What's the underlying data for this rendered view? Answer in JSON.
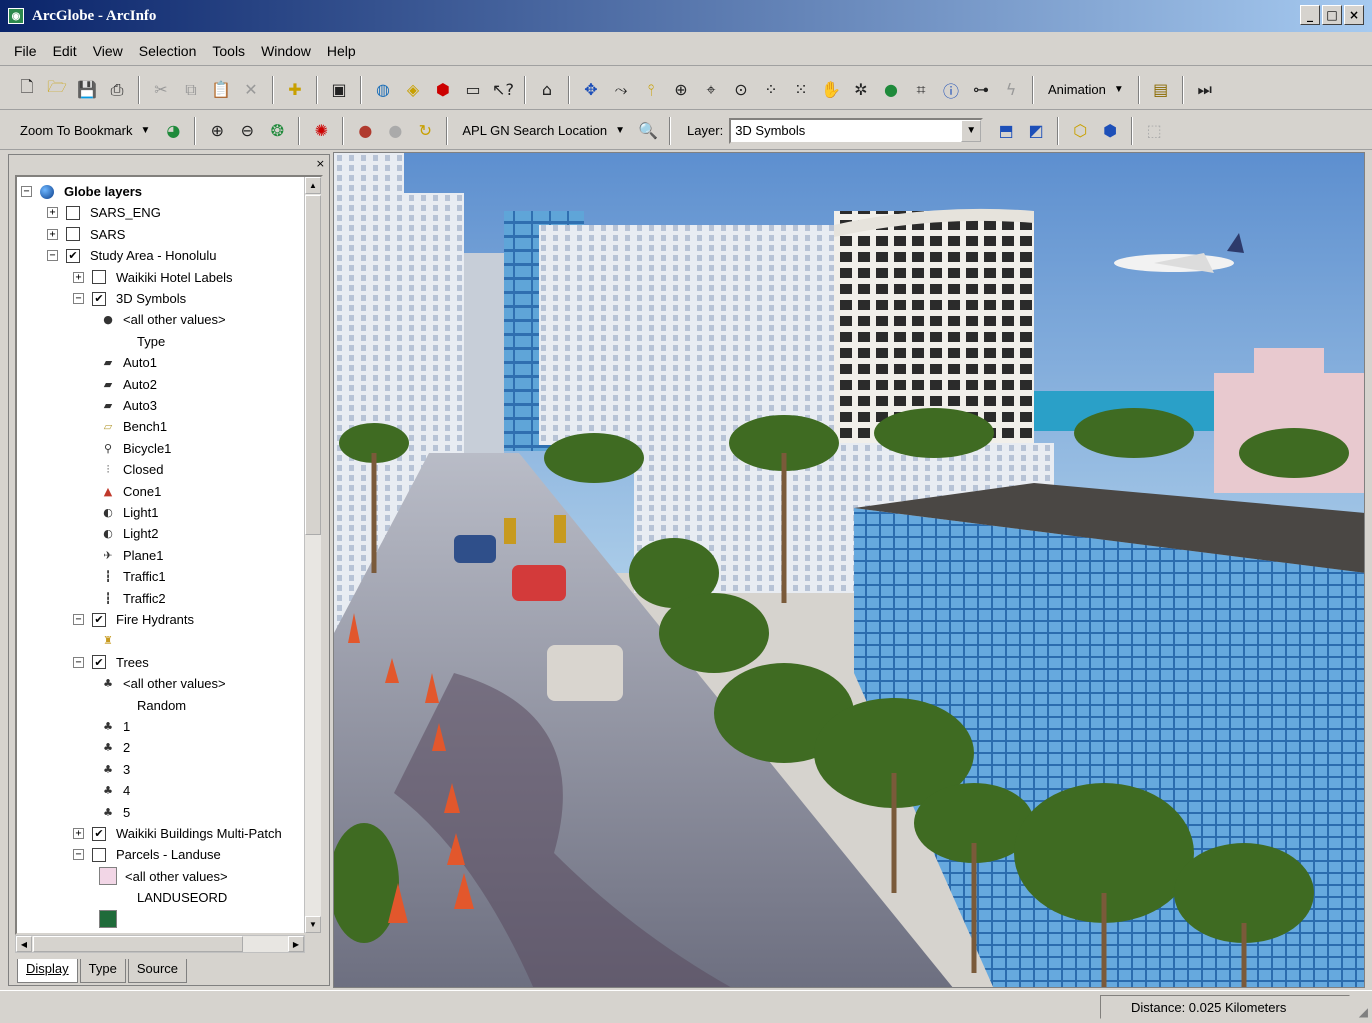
{
  "window": {
    "title": "ArcGlobe - ArcInfo"
  },
  "menu": [
    "File",
    "Edit",
    "View",
    "Selection",
    "Tools",
    "Window",
    "Help"
  ],
  "toolbar1": {
    "animation_label": "Animation"
  },
  "toolbar2": {
    "bookmark_label": "Zoom To Bookmark",
    "search_label": "APL GN Search Location",
    "layer_label": "Layer:",
    "layer_value": "3D Symbols"
  },
  "toc": {
    "items": [
      {
        "label": "Globe layers",
        "level": 0,
        "kind": "root"
      },
      {
        "label": "SARS_ENG",
        "level": 1,
        "kind": "layer",
        "checked": false,
        "expander": "+"
      },
      {
        "label": "SARS",
        "level": 1,
        "kind": "layer",
        "checked": false,
        "expander": "+"
      },
      {
        "label": "Study Area - Honolulu",
        "level": 1,
        "kind": "layer",
        "checked": true,
        "expander": "−"
      },
      {
        "label": "Waikiki Hotel Labels",
        "level": 2,
        "kind": "layer",
        "checked": false,
        "expander": "+"
      },
      {
        "label": "3D Symbols",
        "level": 2,
        "kind": "layer",
        "checked": true,
        "expander": "−"
      },
      {
        "label": "<all other values>",
        "level": 3,
        "kind": "symbol",
        "icon": "dot-icon"
      },
      {
        "label": "Type",
        "level": 4,
        "kind": "heading"
      },
      {
        "label": "Auto1",
        "level": 3,
        "kind": "symbol",
        "icon": "car-icon"
      },
      {
        "label": "Auto2",
        "level": 3,
        "kind": "symbol",
        "icon": "car-icon"
      },
      {
        "label": "Auto3",
        "level": 3,
        "kind": "symbol",
        "icon": "car-icon"
      },
      {
        "label": "Bench1",
        "level": 3,
        "kind": "symbol",
        "icon": "bench-icon"
      },
      {
        "label": "Bicycle1",
        "level": 3,
        "kind": "symbol",
        "icon": "bicycle-icon"
      },
      {
        "label": "Closed",
        "level": 3,
        "kind": "symbol",
        "icon": "closed-icon"
      },
      {
        "label": "Cone1",
        "level": 3,
        "kind": "symbol",
        "icon": "cone-icon"
      },
      {
        "label": "Light1",
        "level": 3,
        "kind": "symbol",
        "icon": "light-icon"
      },
      {
        "label": "Light2",
        "level": 3,
        "kind": "symbol",
        "icon": "light-icon"
      },
      {
        "label": "Plane1",
        "level": 3,
        "kind": "symbol",
        "icon": "plane-icon"
      },
      {
        "label": "Traffic1",
        "level": 3,
        "kind": "symbol",
        "icon": "traffic-icon"
      },
      {
        "label": "Traffic2",
        "level": 3,
        "kind": "symbol",
        "icon": "traffic-icon"
      },
      {
        "label": "Fire Hydrants",
        "level": 2,
        "kind": "layer",
        "checked": true,
        "expander": "−"
      },
      {
        "label": "",
        "level": 3,
        "kind": "symbol",
        "icon": "hydrant-icon"
      },
      {
        "label": "Trees",
        "level": 2,
        "kind": "layer",
        "checked": true,
        "expander": "−"
      },
      {
        "label": "<all other values>",
        "level": 3,
        "kind": "symbol",
        "icon": "tree-icon"
      },
      {
        "label": "Random",
        "level": 4,
        "kind": "heading"
      },
      {
        "label": "1",
        "level": 3,
        "kind": "symbol",
        "icon": "tree-icon"
      },
      {
        "label": "2",
        "level": 3,
        "kind": "symbol",
        "icon": "tree-icon"
      },
      {
        "label": "3",
        "level": 3,
        "kind": "symbol",
        "icon": "tree-icon"
      },
      {
        "label": "4",
        "level": 3,
        "kind": "symbol",
        "icon": "tree-icon"
      },
      {
        "label": "5",
        "level": 3,
        "kind": "symbol",
        "icon": "tree-icon"
      },
      {
        "label": "Waikiki Buildings Multi-Patch",
        "level": 2,
        "kind": "layer",
        "checked": true,
        "expander": "+"
      },
      {
        "label": "Parcels - Landuse",
        "level": 2,
        "kind": "layer",
        "checked": false,
        "expander": "−"
      },
      {
        "label": "<all other values>",
        "level": 3,
        "kind": "swatch",
        "color": "#f2d6e6"
      },
      {
        "label": "LANDUSEORD",
        "level": 4,
        "kind": "heading"
      },
      {
        "label": "",
        "level": 3,
        "kind": "swatch",
        "color": "#1f6b3a"
      }
    ],
    "tabs": [
      "Display",
      "Type",
      "Source"
    ]
  },
  "status": {
    "distance": "Distance:  0.025 Kilometers"
  },
  "colors": {
    "title_start": "#0a246a",
    "title_end": "#a6caf0",
    "sky": "#7fb0e0",
    "sea": "#2aa0c8"
  }
}
